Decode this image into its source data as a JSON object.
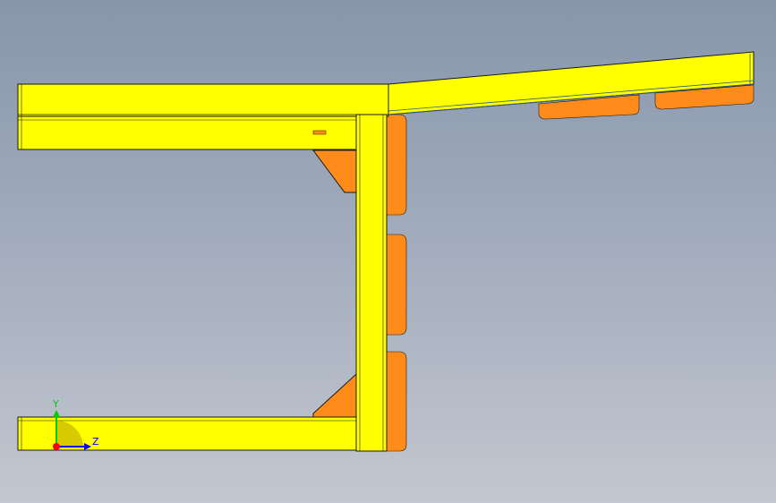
{
  "viewport": {
    "background_top": "#8796ab",
    "background_bottom": "#c3c7d0"
  },
  "model": {
    "member_color": "#ffff00",
    "member_shade": "#e8e800",
    "edge_color": "#1a1a1a",
    "gusset_color": "#ff8c1a",
    "gusset_shade": "#e0700a",
    "ground_edge": "#2f5f80"
  },
  "triad": {
    "y_label": "Y",
    "z_label": "Z",
    "y_color": "#00cc00",
    "z_color": "#0000ff",
    "x_color": "#ff0000",
    "plane_color": "#c8b400"
  }
}
